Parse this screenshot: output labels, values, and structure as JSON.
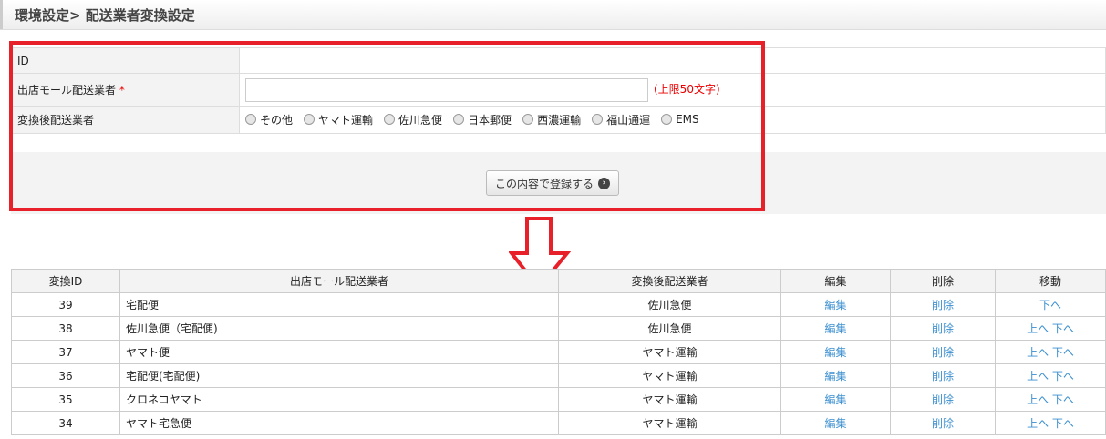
{
  "header": {
    "title": "環境設定> 配送業者変換設定"
  },
  "form": {
    "id_label": "ID",
    "carrier_label": "出店モール配送業者",
    "required": "*",
    "carrier_value": "",
    "limit": "(上限50文字)",
    "converted_label": "変換後配送業者",
    "options": [
      "その他",
      "ヤマト運輸",
      "佐川急便",
      "日本郵便",
      "西濃運輸",
      "福山通運",
      "EMS"
    ],
    "submit": "この内容で登録する"
  },
  "table": {
    "headers": [
      "変換ID",
      "出店モール配送業者",
      "変換後配送業者",
      "編集",
      "削除",
      "移動"
    ],
    "edit": "編集",
    "delete": "削除",
    "up": "上へ",
    "down": "下へ",
    "rows": [
      {
        "id": "39",
        "mall": "宅配便",
        "converted": "佐川急便",
        "up": false
      },
      {
        "id": "38",
        "mall": "佐川急便（宅配便)",
        "converted": "佐川急便",
        "up": true
      },
      {
        "id": "37",
        "mall": "ヤマト便",
        "converted": "ヤマト運輸",
        "up": true
      },
      {
        "id": "36",
        "mall": "宅配便(宅配便)",
        "converted": "ヤマト運輸",
        "up": true
      },
      {
        "id": "35",
        "mall": "クロネコヤマト",
        "converted": "ヤマト運輸",
        "up": true
      },
      {
        "id": "34",
        "mall": "ヤマト宅急便",
        "converted": "ヤマト運輸",
        "up": true
      }
    ]
  },
  "colors": {
    "highlight": "#e8202a",
    "link": "#3b8fd0"
  }
}
